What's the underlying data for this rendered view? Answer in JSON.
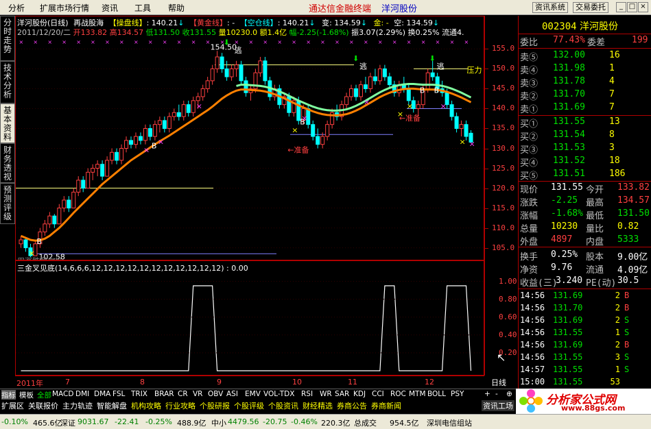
{
  "menu": {
    "items": [
      "分析",
      "扩展市场行情",
      "资讯",
      "工具",
      "帮助"
    ],
    "center_left": "通达信金融终端",
    "center_right": "洋河股份",
    "btn_news": "资讯系统",
    "btn_trade": "交易委托"
  },
  "side_tabs": [
    "分时走势",
    "技术分析",
    "基本资料",
    "财务透视",
    "预测评级"
  ],
  "header": {
    "name": "洋河股份(日线)",
    "title2": "再战股海",
    "l_caopan": "【操盘线】",
    "v_caopan": ": 140.21",
    "l_huangjin": "【黄金线】",
    "v_huangjin": ": -",
    "l_kongcang": "【空仓线】",
    "v_kongcang": ": 140.21",
    "v_bian": "变: 134.59",
    "v_jin": "金: -",
    "v_kong": "空: 134.59",
    "date": "2011/12/20/二",
    "l_open": "开",
    "v_open": "133.82",
    "l_high": "高",
    "v_high": "134.57",
    "l_low": "低",
    "v_low": "131.50",
    "l_close": "收",
    "v_close": "131.55",
    "l_vol": "量",
    "v_vol": "10230.0",
    "l_amt": "额",
    "v_amt": "1.4亿",
    "l_fu": "幅",
    "v_fu": "-2.25(-1.68%)",
    "l_zhen": "振",
    "v_zhen": "3.07(2.29%)",
    "l_huan": "换",
    "v_huan": "0.25%",
    "l_ltong": "流通4."
  },
  "price_axis": [
    "155.0",
    "150.0",
    "145.0",
    "140.0",
    "135.0",
    "130.0",
    "125.0",
    "120.0",
    "115.0",
    "110.0",
    "105.0"
  ],
  "annotations": {
    "high": "154.50",
    "low": "102.58",
    "escape": "逃",
    "prepare": "准备",
    "buy": "B",
    "pressure": "压力",
    "note": "用涨跌量之极"
  },
  "indicator": {
    "title": "三金叉见底(14,6,6,6,12,12,12,12,12,12,12,12,12,12,12) : 0.00",
    "axis": [
      "1.00",
      "0.80",
      "0.60",
      "0.40",
      "0.20"
    ]
  },
  "date_axis": [
    "2011年",
    "7",
    "8",
    "9",
    "10",
    "11",
    "12"
  ],
  "period": "日线",
  "stock": {
    "code": "002304",
    "name": "洋河股份"
  },
  "order_book": {
    "weibi_label": "委比",
    "weibi_value": "77.43%",
    "weicha_label": "委差",
    "weicha_value": "199",
    "asks": [
      {
        "label": "卖⑤",
        "price": "132.00",
        "vol": "16"
      },
      {
        "label": "卖④",
        "price": "131.98",
        "vol": "1"
      },
      {
        "label": "卖③",
        "price": "131.78",
        "vol": "4"
      },
      {
        "label": "卖②",
        "price": "131.70",
        "vol": "7"
      },
      {
        "label": "卖①",
        "price": "131.69",
        "vol": "7"
      }
    ],
    "bids": [
      {
        "label": "买①",
        "price": "131.55",
        "vol": "13"
      },
      {
        "label": "买②",
        "price": "131.54",
        "vol": "8"
      },
      {
        "label": "买③",
        "price": "131.53",
        "vol": "3"
      },
      {
        "label": "买④",
        "price": "131.52",
        "vol": "18"
      },
      {
        "label": "买⑤",
        "price": "131.51",
        "vol": "186"
      }
    ]
  },
  "quote": [
    {
      "l1": "现价",
      "v1": "131.55",
      "c1": "#ffffff",
      "l2": "今开",
      "v2": "133.82",
      "c2": "#ff4040"
    },
    {
      "l1": "涨跌",
      "v1": "-2.25",
      "c1": "#00e000",
      "l2": "最高",
      "v2": "134.57",
      "c2": "#ff4040"
    },
    {
      "l1": "涨幅",
      "v1": "-1.68%",
      "c1": "#00e000",
      "l2": "最低",
      "v2": "131.50",
      "c2": "#00e000"
    },
    {
      "l1": "总量",
      "v1": "10230",
      "c1": "#ffff00",
      "l2": "量比",
      "v2": "0.82",
      "c2": "#ffff00"
    },
    {
      "l1": "外盘",
      "v1": "4897",
      "c1": "#ff4040",
      "l2": "内盘",
      "v2": "5333",
      "c2": "#00e000"
    },
    {
      "l1": "换手",
      "v1": "0.25%",
      "c1": "#ffffff",
      "l2": "股本",
      "v2": "9.00亿",
      "c2": "#ffffff"
    },
    {
      "l1": "净资",
      "v1": "9.76",
      "c1": "#ffffff",
      "l2": "流通",
      "v2": "4.09亿",
      "c2": "#ffffff"
    },
    {
      "l1": "收益(三)",
      "v1": "3.240",
      "c1": "#ffffff",
      "l2": "PE(动)",
      "v2": "30.5",
      "c2": "#ffffff"
    }
  ],
  "ticks": [
    {
      "time": "14:56",
      "price": "131.69",
      "vol": "2",
      "bs": "B"
    },
    {
      "time": "14:56",
      "price": "131.70",
      "vol": "2",
      "bs": "B"
    },
    {
      "time": "14:56",
      "price": "131.69",
      "vol": "2",
      "bs": "S"
    },
    {
      "time": "14:56",
      "price": "131.55",
      "vol": "1",
      "bs": "S"
    },
    {
      "time": "14:56",
      "price": "131.69",
      "vol": "2",
      "bs": "B"
    },
    {
      "time": "14:56",
      "price": "131.55",
      "vol": "3",
      "bs": "S"
    },
    {
      "time": "14:57",
      "price": "131.55",
      "vol": "1",
      "bs": "S"
    },
    {
      "time": "15:00",
      "price": "131.55",
      "vol": "53",
      "bs": ""
    }
  ],
  "indicator_tabs": [
    "指标",
    "模板",
    "全部",
    "MACD",
    "DMI",
    "DMA",
    "FSL",
    "TRIX",
    "BRAR",
    "CR",
    "VR",
    "OBV",
    "ASI",
    "EMV",
    "VOL-TDX",
    "RSI",
    "WR",
    "SAR",
    "KDJ",
    "CCI",
    "ROC",
    "MTM",
    "BOLL",
    "PSY"
  ],
  "ind_controls": [
    "+",
    "-",
    "⊕"
  ],
  "category_tabs": [
    "扩展区",
    "关联报价",
    "主力轨迹",
    "智能解盘",
    "机构攻略",
    "行业攻略",
    "个股研报",
    "个股评级",
    "个股资讯",
    "财经精选",
    "券商公告",
    "券商新闻"
  ],
  "news_label": "资讯工场",
  "watermark": {
    "name": "分析家公式网",
    "url": "www.88gs.com"
  },
  "status": {
    "s1": "-0.10%",
    "s2": "465.6亿",
    "s3_label": "深证",
    "s3_val": "9031.67",
    "s4": "-22.41",
    "s5": "-0.25%",
    "s6": "488.9亿",
    "s7_label": "中小",
    "s7_val": "4479.56",
    "s8": "-20.75",
    "s9": "-0.46%",
    "s10": "220.3亿",
    "s11": "总成交",
    "s12": "954.5亿",
    "s13": "深圳电信组站"
  },
  "colors": {
    "up": "#ff4040",
    "down": "#00e000",
    "yellow": "#ffff00",
    "cyan": "#00ffff",
    "magenta": "#ff40ff",
    "grid": "#b00000"
  },
  "chart_data": {
    "type": "candlestick",
    "ylim": [
      102,
      158
    ],
    "candles": [
      [
        106,
        108,
        105,
        107
      ],
      [
        107,
        107.5,
        104,
        105
      ],
      [
        105,
        106,
        102.58,
        103
      ],
      [
        103,
        107,
        103,
        106
      ],
      [
        106,
        110,
        105,
        109
      ],
      [
        109,
        112,
        108,
        111
      ],
      [
        111,
        114,
        110,
        113
      ],
      [
        113,
        113.5,
        110,
        111
      ],
      [
        111,
        116,
        111,
        115
      ],
      [
        115,
        118,
        114,
        117
      ],
      [
        117,
        118,
        114,
        115
      ],
      [
        115,
        120,
        115,
        119
      ],
      [
        119,
        123,
        118,
        122
      ],
      [
        122,
        123,
        119,
        120
      ],
      [
        120,
        125,
        120,
        124
      ],
      [
        124,
        126,
        122,
        125
      ],
      [
        125,
        127,
        123,
        126
      ],
      [
        126,
        127,
        122,
        123
      ],
      [
        123,
        128,
        123,
        127
      ],
      [
        127,
        130,
        126,
        129
      ],
      [
        129,
        130,
        126,
        127
      ],
      [
        127,
        131,
        126,
        130
      ],
      [
        130,
        133,
        129,
        132
      ],
      [
        132,
        133,
        130,
        131
      ],
      [
        131,
        134,
        130,
        133
      ],
      [
        133,
        134,
        131,
        132
      ],
      [
        132,
        136,
        131,
        135
      ],
      [
        135,
        136,
        132,
        133
      ],
      [
        133,
        137,
        132,
        136
      ],
      [
        136,
        138,
        134,
        137
      ],
      [
        137,
        138,
        134,
        135
      ],
      [
        135,
        139,
        134,
        138
      ],
      [
        138,
        140,
        137,
        139
      ],
      [
        139,
        141,
        137,
        138
      ],
      [
        138,
        142,
        137,
        141
      ],
      [
        141,
        142,
        138,
        139
      ],
      [
        139,
        143,
        138,
        142
      ],
      [
        142,
        144,
        140,
        143
      ],
      [
        143,
        146,
        142,
        145
      ],
      [
        145,
        148,
        144,
        147
      ],
      [
        147,
        151,
        146,
        150
      ],
      [
        150,
        154.5,
        149,
        153
      ],
      [
        153,
        154,
        149,
        150
      ],
      [
        150,
        152,
        147,
        148
      ],
      [
        148,
        151,
        147,
        150
      ],
      [
        150,
        152,
        148,
        151
      ],
      [
        151,
        152,
        146,
        147
      ],
      [
        147,
        148,
        143,
        144
      ],
      [
        144,
        146,
        142,
        145
      ],
      [
        145,
        150,
        144,
        149
      ],
      [
        149,
        153,
        148,
        152
      ],
      [
        152,
        153,
        146,
        147
      ],
      [
        147,
        148,
        142,
        143
      ],
      [
        143,
        146,
        142,
        145
      ],
      [
        145,
        146,
        140,
        141
      ],
      [
        141,
        144,
        140,
        143
      ],
      [
        143,
        144,
        138,
        139
      ],
      [
        139,
        143,
        138,
        142
      ],
      [
        142,
        143,
        136,
        137
      ],
      [
        137,
        141,
        136,
        140
      ],
      [
        140,
        141,
        135,
        136
      ],
      [
        136,
        137,
        132,
        133
      ],
      [
        133,
        135,
        130,
        131
      ],
      [
        131,
        134,
        130,
        133
      ],
      [
        133,
        137,
        132,
        136
      ],
      [
        136,
        140,
        135,
        139
      ],
      [
        139,
        141,
        137,
        138
      ],
      [
        138,
        142,
        137,
        141
      ],
      [
        141,
        144,
        140,
        143
      ],
      [
        143,
        146,
        142,
        145
      ],
      [
        145,
        146,
        142,
        143
      ],
      [
        143,
        147,
        142,
        146
      ],
      [
        146,
        148,
        144,
        145
      ],
      [
        145,
        149,
        144,
        148
      ],
      [
        148,
        150,
        146,
        147
      ],
      [
        147,
        151,
        146,
        150
      ],
      [
        150,
        151,
        147,
        148
      ],
      [
        148,
        149,
        145,
        146
      ],
      [
        146,
        147,
        143,
        144
      ],
      [
        144,
        147,
        143,
        146
      ],
      [
        146,
        148,
        144,
        145
      ],
      [
        145,
        146,
        141,
        142
      ],
      [
        142,
        143,
        139,
        140
      ],
      [
        140,
        142,
        138,
        141
      ],
      [
        141,
        146,
        140,
        145
      ],
      [
        145,
        150,
        144,
        149
      ],
      [
        149,
        152,
        147,
        148
      ],
      [
        148,
        149,
        144,
        145
      ],
      [
        145,
        147,
        143,
        144
      ],
      [
        144,
        145,
        140,
        141
      ],
      [
        141,
        142,
        137,
        138
      ],
      [
        138,
        139,
        134,
        135
      ],
      [
        135,
        137,
        133,
        136
      ],
      [
        136,
        137,
        132,
        133
      ],
      [
        133.82,
        134.57,
        131.5,
        131.55
      ]
    ],
    "ma": [
      108,
      107.5,
      107,
      106.8,
      106.9,
      107.3,
      108,
      109,
      110,
      111.2,
      112.5,
      113.8,
      115,
      116.2,
      117.4,
      118.6,
      119.8,
      121,
      122,
      123,
      124,
      125,
      126,
      127,
      127.8,
      128.6,
      129.4,
      130.2,
      131,
      131.8,
      132.5,
      133.2,
      134,
      134.8,
      135.6,
      136.4,
      137.2,
      138,
      138.8,
      139.6,
      140.5,
      141.5,
      142.5,
      143.3,
      144,
      144.5,
      144.8,
      144.8,
      144.7,
      144.6,
      144.5,
      144.3,
      144,
      143.6,
      143.1,
      142.6,
      142,
      141.4,
      140.8,
      140.3,
      139.8,
      139.3,
      138.9,
      138.6,
      138.4,
      138.3,
      138.3,
      138.4,
      138.6,
      139,
      139.5,
      140.1,
      140.8,
      141.5,
      142.2,
      142.9,
      143.5,
      144,
      144.4,
      144.7,
      144.9,
      145,
      145,
      144.9,
      144.8,
      144.8,
      144.8,
      144.7,
      144.5,
      144.2,
      143.8,
      143.3,
      142.8,
      142.2,
      141.6
    ],
    "indicator_series": {
      "name": "三金叉见底",
      "values": [
        0,
        0,
        0,
        0,
        0,
        0,
        0,
        0,
        0,
        0,
        0,
        0,
        0,
        0,
        0,
        0,
        0,
        0,
        0,
        0,
        0,
        0,
        0,
        0,
        0,
        0,
        0,
        0,
        0,
        0,
        0,
        0,
        0,
        0,
        0,
        0,
        0,
        0,
        0,
        0,
        0,
        0,
        0,
        0,
        0,
        0,
        0,
        0,
        0,
        0,
        0,
        0,
        0,
        0,
        0,
        0,
        0,
        0,
        0,
        0,
        0,
        0,
        0,
        0,
        0,
        0,
        0,
        0,
        0,
        0,
        0,
        0,
        0,
        0,
        0,
        0,
        0,
        0,
        0,
        0,
        0,
        0,
        0,
        0,
        0,
        0,
        0,
        0,
        0,
        0,
        0,
        0,
        0,
        0,
        0
      ]
    },
    "indicator_ylim": [
      0,
      1.05
    ]
  }
}
